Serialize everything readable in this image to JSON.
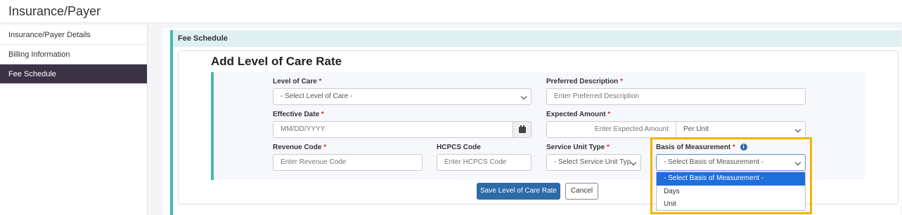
{
  "page": {
    "title": "Insurance/Payer"
  },
  "sidebar": {
    "items": [
      {
        "label": "Insurance/Payer Details"
      },
      {
        "label": "Billing Information"
      },
      {
        "label": "Fee Schedule"
      }
    ]
  },
  "section": {
    "title": "Fee Schedule"
  },
  "form": {
    "title": "Add Level of Care Rate",
    "required_mark": "*",
    "level_of_care": {
      "label": "Level of Care",
      "value": "- Select Level of Care -"
    },
    "preferred_description": {
      "label": "Preferred Description",
      "placeholder": "Enter Preferred Description"
    },
    "effective_date": {
      "label": "Effective Date",
      "placeholder": "MM/DD/YYYY"
    },
    "expected_amount": {
      "label": "Expected Amount",
      "placeholder": "Enter Expected Amount",
      "unit_value": "Per Unit"
    },
    "revenue_code": {
      "label": "Revenue Code",
      "placeholder": "Enter Revenue Code"
    },
    "hcpcs_code": {
      "label": "HCPCS Code",
      "placeholder": "Enter HCPCS Code"
    },
    "service_unit_type": {
      "label": "Service Unit Type",
      "value": "- Select Service Unit Typ"
    },
    "basis_of_measurement": {
      "label": "Basis of Measurement",
      "value": "- Select Basis of Measurement -",
      "options": [
        "- Select Basis of Measurement -",
        "Days",
        "Unit"
      ],
      "selected_index": 0
    },
    "save_label": "Save Level of Care Rate",
    "cancel_label": "Cancel"
  },
  "colors": {
    "accent": "#45b8b0",
    "primary": "#2d6aa8",
    "highlight": "#f0b400",
    "active_nav": "#3b3345"
  }
}
